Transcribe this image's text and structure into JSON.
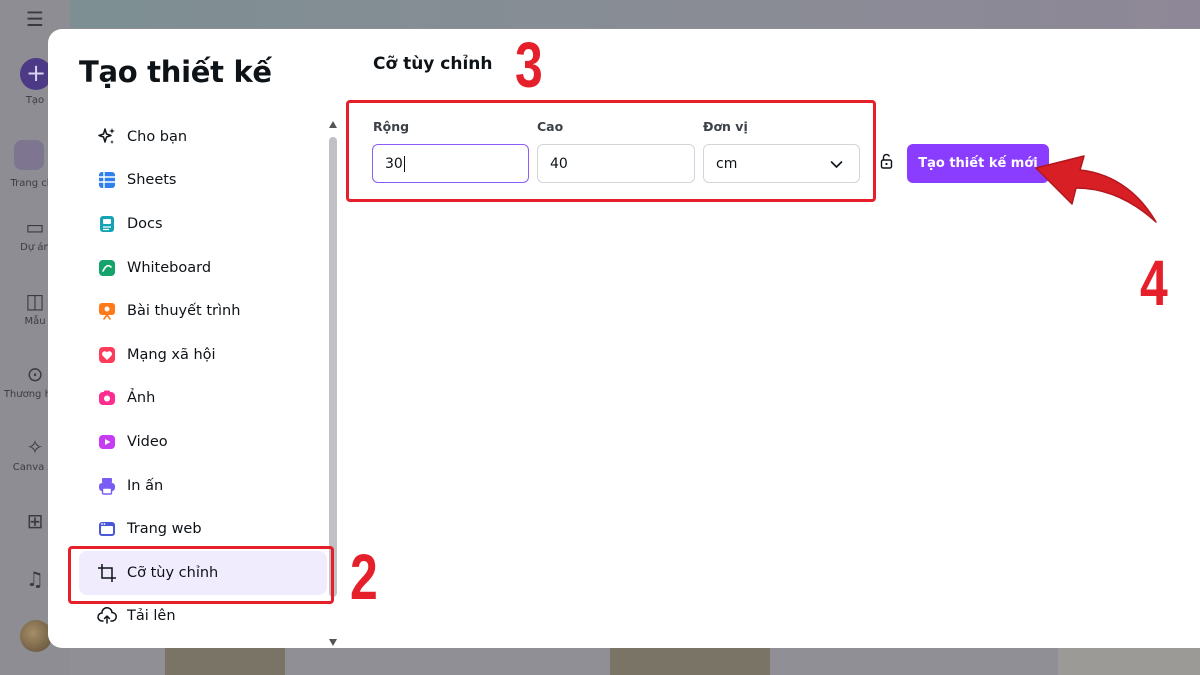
{
  "background": {
    "rail": [
      {
        "label": "Tạo",
        "icon": "plus-icon"
      },
      {
        "label": "Trang chủ",
        "icon": "home-icon"
      },
      {
        "label": "Dự án",
        "icon": "folder-icon"
      },
      {
        "label": "Mẫu",
        "icon": "templates-icon"
      },
      {
        "label": "Thương hiệu",
        "icon": "brand-icon"
      },
      {
        "label": "Canva AI",
        "icon": "sparkle-icon"
      }
    ]
  },
  "modal": {
    "title": "Tạo thiết kế",
    "nav": [
      {
        "label": "Cho bạn",
        "icon": "sparkle-icon"
      },
      {
        "label": "Sheets",
        "icon": "sheets-icon"
      },
      {
        "label": "Docs",
        "icon": "docs-icon"
      },
      {
        "label": "Whiteboard",
        "icon": "whiteboard-icon"
      },
      {
        "label": "Bài thuyết trình",
        "icon": "presentation-icon"
      },
      {
        "label": "Mạng xã hội",
        "icon": "heart-icon"
      },
      {
        "label": "Ảnh",
        "icon": "camera-icon"
      },
      {
        "label": "Video",
        "icon": "video-icon"
      },
      {
        "label": "In ấn",
        "icon": "printer-icon"
      },
      {
        "label": "Trang web",
        "icon": "website-icon"
      },
      {
        "label": "Cỡ tùy chỉnh",
        "icon": "custom-size-icon",
        "active": true
      },
      {
        "label": "Tải lên",
        "icon": "upload-icon"
      }
    ],
    "custom_size": {
      "title": "Cỡ tùy chỉnh",
      "width_label": "Rộng",
      "width_value": "30",
      "height_label": "Cao",
      "height_value": "40",
      "unit_label": "Đơn vị",
      "unit_value": "cm",
      "create_button": "Tạo thiết kế mới"
    }
  },
  "annotations": {
    "step2": "2",
    "step3": "3",
    "step4": "4"
  },
  "colors": {
    "accent": "#8b3dff",
    "highlight": "#e5202b",
    "active_bg": "#f0ecfd"
  }
}
